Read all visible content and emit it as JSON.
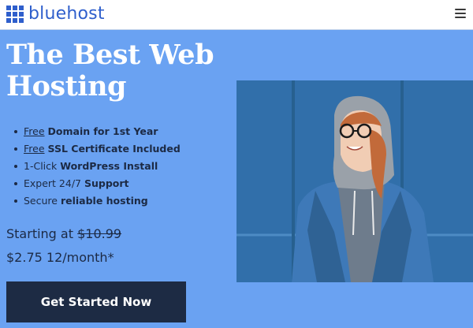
{
  "brand": {
    "name": "bluehost",
    "accent": "#2f5fcc"
  },
  "header": {
    "menu_icon": "hamburger-menu-icon"
  },
  "hero": {
    "headline_line1": "The Best Web",
    "headline_line2": "Hosting",
    "features": [
      {
        "prefix": "",
        "underlined": "Free",
        "bold": "Domain for 1st Year",
        "suffix": ""
      },
      {
        "prefix": "",
        "underlined": "Free",
        "bold": "SSL Certificate Included",
        "suffix": ""
      },
      {
        "prefix": "1-Click ",
        "underlined": "",
        "bold": "WordPress Install",
        "suffix": ""
      },
      {
        "prefix": "Expert 24/7 ",
        "underlined": "",
        "bold": "Support",
        "suffix": ""
      },
      {
        "prefix": "Secure ",
        "underlined": "",
        "bold": "reliable hosting",
        "suffix": ""
      }
    ],
    "price": {
      "starting_label": "Starting at",
      "old_price": "$10.99",
      "new_price": "$2.75 12/month*"
    },
    "cta_label": "Get Started Now"
  },
  "colors": {
    "background": "#6aa2f2",
    "cta": "#1d2b44",
    "text": "#1c2a44"
  }
}
